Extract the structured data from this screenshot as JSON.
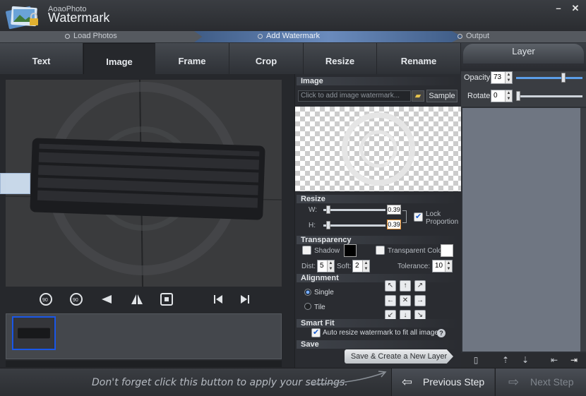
{
  "app": {
    "brand_small": "AoaoPhoto",
    "brand_big": "Watermark"
  },
  "window_controls": {
    "minimize": "–",
    "close": "✕"
  },
  "steps": [
    {
      "label": "Load Photos",
      "active": false
    },
    {
      "label": "Add Watermark",
      "active": true
    },
    {
      "label": "Output",
      "active": false
    }
  ],
  "tabs": [
    "Text",
    "Image",
    "Frame",
    "Crop",
    "Resize",
    "Rename"
  ],
  "active_tab": "Image",
  "image_section": {
    "title": "Image",
    "placeholder": "Click to add image watermark...",
    "sample_label": "Sample"
  },
  "resize_section": {
    "title": "Resize",
    "w_label": "W:",
    "w_value": "0.39",
    "h_label": "H:",
    "h_value": "0.39",
    "lock_label": "Lock Proportion",
    "lock_checked": true
  },
  "transparency_section": {
    "title": "Transparency",
    "shadow_label": "Shadow",
    "shadow_checked": false,
    "transparent_color_label": "Transparent Color",
    "transparent_checked": false,
    "dist_label": "Dist:",
    "dist_value": "5",
    "soft_label": "Soft:",
    "soft_value": "2",
    "tolerance_label": "Tolerance:",
    "tolerance_value": "10",
    "shadow_color": "#000000",
    "transparent_color": "#ffffff"
  },
  "alignment_section": {
    "title": "Alignment",
    "single_label": "Single",
    "tile_label": "Tile",
    "selected": "Single"
  },
  "smartfit_section": {
    "title": "Smart Fit",
    "auto_label": "Auto resize watermark to fit all images.",
    "auto_checked": true
  },
  "save_section": {
    "title": "Save",
    "button_label": "Save & Create a New Layer"
  },
  "layer_panel": {
    "title": "Layer",
    "opacity_label": "Opacity",
    "opacity_value": "73",
    "rotate_label": "Rotate",
    "rotate_value": "0"
  },
  "bottom": {
    "hint": "Don't forget click this button to apply your settings.",
    "prev_label": "Previous Step",
    "next_label": "Next Step"
  },
  "colors": {
    "accent": "#1a57e8",
    "step_active": "#6a8bbd"
  }
}
